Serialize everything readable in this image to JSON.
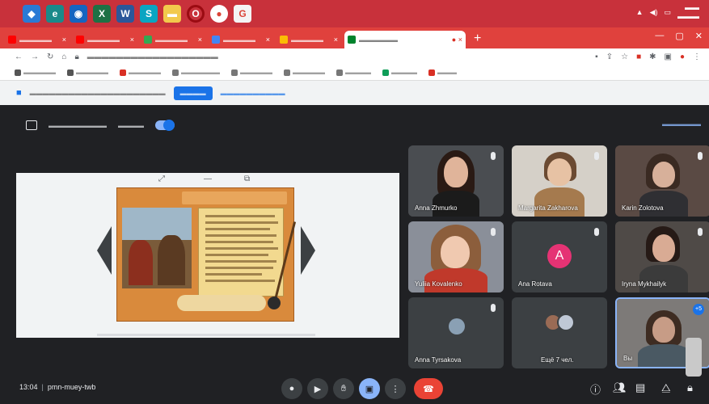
{
  "meeting": {
    "time": "13:04",
    "code": "pmn-muey-twb",
    "participants": [
      {
        "name": "Anna Zhmurko"
      },
      {
        "name": "Margarita Zakharova"
      },
      {
        "name": "Karin Zolotova"
      },
      {
        "name": "Yuliia Kovalenko"
      },
      {
        "name": "Ana Rotava",
        "initial": "A"
      },
      {
        "name": "Iryna Mykhailyk"
      },
      {
        "name": "Anna Tyrsakova"
      },
      {
        "name": "Ещё 7 чел."
      },
      {
        "name": "Вы",
        "badge": "+5"
      }
    ]
  }
}
